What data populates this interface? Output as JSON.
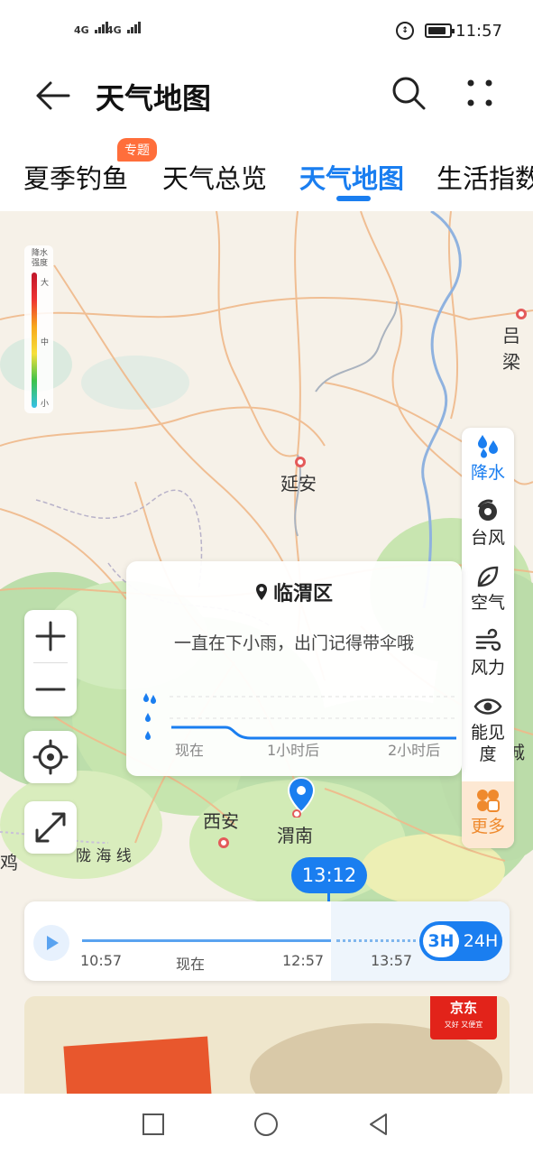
{
  "status_bar": {
    "signal1": "4G",
    "signal2": "4G",
    "time": "11:57",
    "battery_level": 0.85
  },
  "header": {
    "title": "天气地图",
    "back_icon": "arrow-left-icon",
    "search_icon": "search-icon",
    "more_icon": "dots-grid-icon"
  },
  "tabs": {
    "items": [
      {
        "label": "夏季钓鱼",
        "badge": "专题"
      },
      {
        "label": "天气总览"
      },
      {
        "label": "天气地图",
        "active": true
      },
      {
        "label": "生活指数"
      }
    ]
  },
  "legend": {
    "title": "降水强度",
    "levels": [
      "大",
      "中",
      "小"
    ]
  },
  "map": {
    "cities": [
      {
        "name": "吕梁"
      },
      {
        "name": "延安"
      },
      {
        "name": "西安"
      },
      {
        "name": "渭南"
      },
      {
        "name": "鸡"
      },
      {
        "name": "陇 海 线"
      },
      {
        "name": "城"
      }
    ]
  },
  "layers": {
    "items": [
      {
        "label": "降水",
        "icon": "rain-drops-icon",
        "active": true
      },
      {
        "label": "台风",
        "icon": "typhoon-icon"
      },
      {
        "label": "空气",
        "icon": "leaf-icon"
      },
      {
        "label": "风力",
        "icon": "wind-icon"
      },
      {
        "label": "能见度",
        "icon": "eye-icon"
      },
      {
        "label": "更多",
        "icon": "more-petals-icon"
      }
    ]
  },
  "popup": {
    "place": "临渭区",
    "description": "一直在下小雨，出门记得带伞哦",
    "axis": [
      "现在",
      "1小时后",
      "2小时后"
    ]
  },
  "timeline": {
    "current_time": "13:12",
    "ticks": [
      "10:57",
      "现在",
      "12:57",
      "13:57"
    ],
    "toggle": {
      "selected": "3H",
      "other": "24H"
    }
  },
  "ad": {
    "brand": "京东",
    "slogan": "又好 又便宜"
  },
  "colors": {
    "accent": "#1a7ef0",
    "badge": "#ff6e3b",
    "more_layer": "#ef8a2e"
  }
}
